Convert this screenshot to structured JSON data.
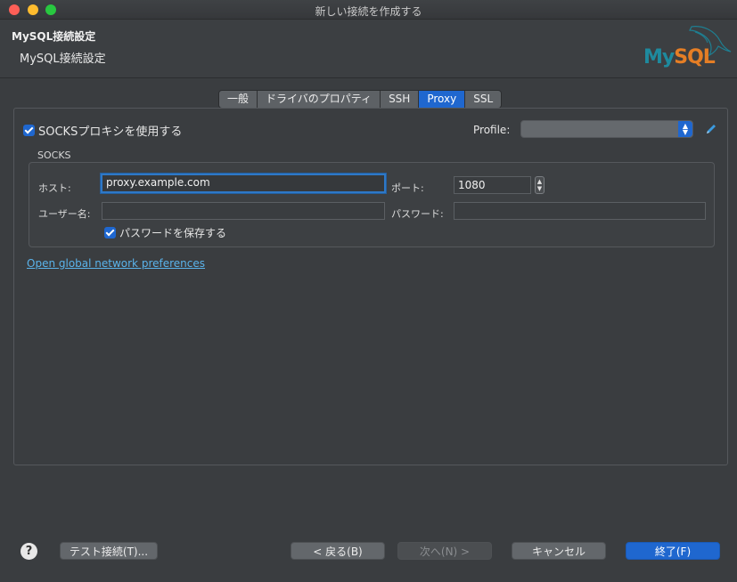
{
  "window": {
    "title": "新しい接続を作成する"
  },
  "header": {
    "title": "MySQL接続設定",
    "subtitle": "MySQL接続設定",
    "logo_my": "My",
    "logo_sql": "SQL"
  },
  "tabs": [
    {
      "label": "一般"
    },
    {
      "label": "ドライバのプロパティ"
    },
    {
      "label": "SSH"
    },
    {
      "label": "Proxy"
    },
    {
      "label": "SSL"
    }
  ],
  "proxy": {
    "use_socks_label": "SOCKSプロキシを使用する",
    "use_socks_checked": true,
    "profile_label": "Profile:",
    "profile_value": "",
    "group_label": "SOCKS",
    "host_label": "ホスト:",
    "host_value": "proxy.example.com",
    "port_label": "ポート:",
    "port_value": "1080",
    "user_label": "ユーザー名:",
    "user_value": "",
    "password_label": "パスワード:",
    "password_value": "",
    "save_password_label": "パスワードを保存する",
    "save_password_checked": true,
    "network_link": "Open global network preferences"
  },
  "footer": {
    "help": "?",
    "test_button": "テスト接続(T)...",
    "back_button": "< 戻る(B)",
    "next_button": "次へ(N) >",
    "cancel_button": "キャンセル",
    "finish_button": "終了(F)"
  },
  "colors": {
    "accent": "#1f67cf",
    "link": "#5ab3ea",
    "background": "#3a3d40"
  }
}
